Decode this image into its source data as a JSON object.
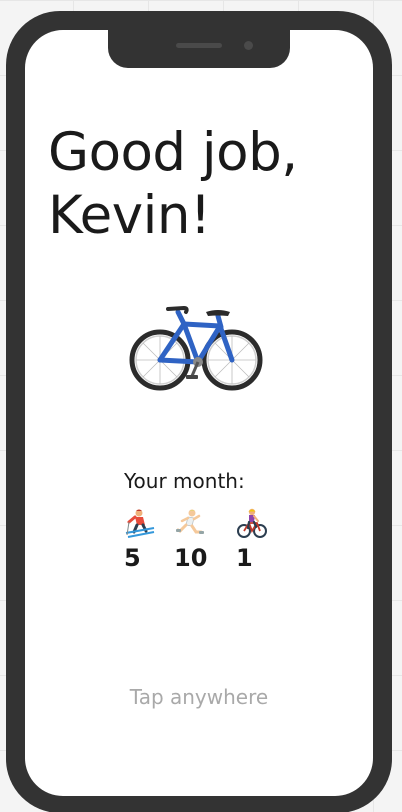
{
  "greeting": {
    "line1": "Good job,",
    "line2": "Kevin!"
  },
  "hero_icon": "bicycle-icon",
  "month": {
    "label": "Your month:",
    "stats": [
      {
        "icon": "skier-icon",
        "value": "5"
      },
      {
        "icon": "runner-icon",
        "value": "10"
      },
      {
        "icon": "cyclist-icon",
        "value": "1"
      }
    ]
  },
  "hint": "Tap anywhere",
  "colors": {
    "frame": "#333333",
    "screen": "#ffffff",
    "text": "#1a1a1a",
    "hint": "#a9a9a9",
    "bike_blue": "#2f63c4"
  }
}
